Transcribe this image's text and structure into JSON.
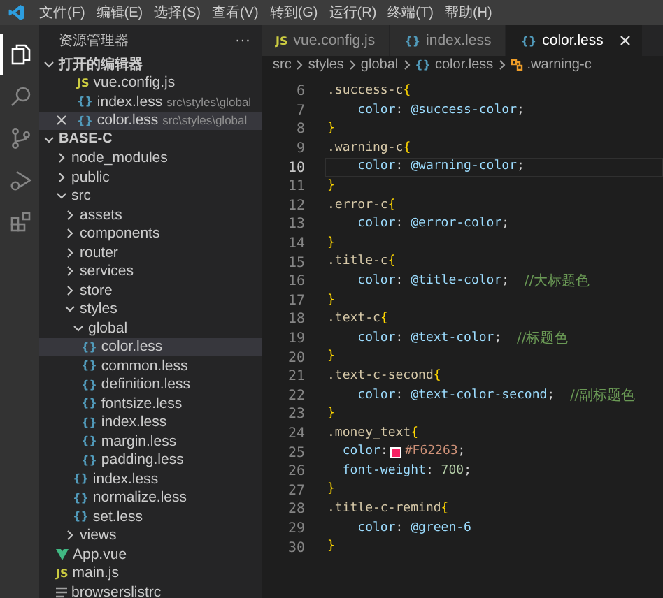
{
  "menu": [
    "文件(F)",
    "编辑(E)",
    "选择(S)",
    "查看(V)",
    "转到(G)",
    "运行(R)",
    "终端(T)",
    "帮助(H)"
  ],
  "activity_bar": [
    {
      "kind": "files",
      "selected": true
    },
    {
      "kind": "search",
      "selected": false
    },
    {
      "kind": "source-control",
      "selected": false
    },
    {
      "kind": "run",
      "selected": false
    },
    {
      "kind": "extensions",
      "selected": false
    }
  ],
  "sidebar": {
    "title": "资源管理器",
    "more": "···",
    "open_editors": {
      "title": "打开的编辑器",
      "expanded": true,
      "items": [
        {
          "kind": "js",
          "badge": "JS",
          "name": "vue.config.js",
          "selected": false
        },
        {
          "kind": "less",
          "badge": "{}",
          "name": "index.less",
          "path": "src\\styles\\global",
          "selected": false
        },
        {
          "kind": "less",
          "badge": "{}",
          "name": "color.less",
          "path": "src\\styles\\global",
          "selected": true
        }
      ]
    },
    "project": {
      "title": "BASE-C",
      "expanded": true,
      "tree": [
        {
          "kind": "folder",
          "name": "node_modules",
          "expanded": false,
          "selected": false
        },
        {
          "kind": "folder",
          "name": "public",
          "expanded": false,
          "selected": false
        },
        {
          "kind": "folder",
          "name": "src",
          "expanded": true,
          "selected": false,
          "children": [
            {
              "kind": "folder",
              "name": "assets",
              "expanded": false,
              "selected": false
            },
            {
              "kind": "folder",
              "name": "components",
              "expanded": false,
              "selected": false
            },
            {
              "kind": "folder",
              "name": "router",
              "expanded": false,
              "selected": false
            },
            {
              "kind": "folder",
              "name": "services",
              "expanded": false,
              "selected": false
            },
            {
              "kind": "folder",
              "name": "store",
              "expanded": false,
              "selected": false
            },
            {
              "kind": "folder",
              "name": "styles",
              "expanded": true,
              "selected": false,
              "children": [
                {
                  "kind": "folder",
                  "name": "global",
                  "expanded": true,
                  "selected": false,
                  "children": [
                    {
                      "kind": "less",
                      "badge": "{}",
                      "name": "color.less",
                      "selected": true
                    },
                    {
                      "kind": "less",
                      "badge": "{}",
                      "name": "common.less",
                      "selected": false
                    },
                    {
                      "kind": "less",
                      "badge": "{}",
                      "name": "definition.less",
                      "selected": false
                    },
                    {
                      "kind": "less",
                      "badge": "{}",
                      "name": "fontsize.less",
                      "selected": false
                    },
                    {
                      "kind": "less",
                      "badge": "{}",
                      "name": "index.less",
                      "selected": false
                    },
                    {
                      "kind": "less",
                      "badge": "{}",
                      "name": "margin.less",
                      "selected": false
                    },
                    {
                      "kind": "less",
                      "badge": "{}",
                      "name": "padding.less",
                      "selected": false
                    }
                  ]
                },
                {
                  "kind": "less",
                  "badge": "{}",
                  "name": "index.less",
                  "selected": false
                },
                {
                  "kind": "less",
                  "badge": "{}",
                  "name": "normalize.less",
                  "selected": false
                },
                {
                  "kind": "less",
                  "badge": "{}",
                  "name": "set.less",
                  "selected": false
                }
              ]
            },
            {
              "kind": "folder",
              "name": "views",
              "expanded": false,
              "selected": false
            }
          ]
        },
        {
          "kind": "vue",
          "name": "App.vue",
          "selected": false
        },
        {
          "kind": "js",
          "badge": "JS",
          "name": "main.js",
          "selected": false
        },
        {
          "kind": "file",
          "name": "browserslistrc",
          "selected": false
        }
      ]
    }
  },
  "tabs": [
    {
      "kind": "js",
      "badge": "JS",
      "label": "vue.config.js",
      "selected": false
    },
    {
      "kind": "less",
      "badge": "{}",
      "label": "index.less",
      "selected": false
    },
    {
      "kind": "less",
      "badge": "{}",
      "label": "color.less",
      "selected": true
    }
  ],
  "breadcrumbs": [
    {
      "kind": "folder",
      "text": "src"
    },
    {
      "kind": "folder",
      "text": "styles"
    },
    {
      "kind": "folder",
      "text": "global"
    },
    {
      "kind": "less",
      "badge": "{}",
      "text": "color.less"
    },
    {
      "kind": "symbol",
      "text": ".warning-c"
    }
  ],
  "code": [
    {
      "number": "6",
      "current": false,
      "tokens": [
        {
          "kind": "selector",
          "text": ".success-c"
        },
        {
          "kind": "brace",
          "text": "{"
        }
      ]
    },
    {
      "number": "7",
      "current": false,
      "tokens": [
        {
          "kind": "property",
          "text": "    color"
        },
        {
          "kind": "punct",
          "text": ": "
        },
        {
          "kind": "variable",
          "text": "@success-color"
        },
        {
          "kind": "punct",
          "text": ";"
        }
      ]
    },
    {
      "number": "8",
      "current": false,
      "tokens": [
        {
          "kind": "brace",
          "text": "}"
        }
      ]
    },
    {
      "number": "9",
      "current": false,
      "tokens": [
        {
          "kind": "selector",
          "text": ".warning-c"
        },
        {
          "kind": "brace",
          "text": "{"
        }
      ]
    },
    {
      "number": "10",
      "current": true,
      "tokens": [
        {
          "kind": "property",
          "text": "    color"
        },
        {
          "kind": "punct",
          "text": ": "
        },
        {
          "kind": "variable",
          "text": "@warning-color"
        },
        {
          "kind": "punct",
          "text": ";"
        }
      ]
    },
    {
      "number": "11",
      "current": false,
      "tokens": [
        {
          "kind": "brace",
          "text": "}"
        }
      ]
    },
    {
      "number": "12",
      "current": false,
      "tokens": [
        {
          "kind": "selector",
          "text": ".error-c"
        },
        {
          "kind": "brace",
          "text": "{"
        }
      ]
    },
    {
      "number": "13",
      "current": false,
      "tokens": [
        {
          "kind": "property",
          "text": "    color"
        },
        {
          "kind": "punct",
          "text": ": "
        },
        {
          "kind": "variable",
          "text": "@error-color"
        },
        {
          "kind": "punct",
          "text": ";"
        }
      ]
    },
    {
      "number": "14",
      "current": false,
      "tokens": [
        {
          "kind": "brace",
          "text": "}"
        }
      ]
    },
    {
      "number": "15",
      "current": false,
      "tokens": [
        {
          "kind": "selector",
          "text": ".title-c"
        },
        {
          "kind": "brace",
          "text": "{"
        }
      ]
    },
    {
      "number": "16",
      "current": false,
      "tokens": [
        {
          "kind": "property",
          "text": "    color"
        },
        {
          "kind": "punct",
          "text": ": "
        },
        {
          "kind": "variable",
          "text": "@title-color"
        },
        {
          "kind": "punct",
          "text": ";  "
        },
        {
          "kind": "comment",
          "text": "//大标题色"
        }
      ]
    },
    {
      "number": "17",
      "current": false,
      "tokens": [
        {
          "kind": "brace",
          "text": "}"
        }
      ]
    },
    {
      "number": "18",
      "current": false,
      "tokens": [
        {
          "kind": "selector",
          "text": ".text-c"
        },
        {
          "kind": "brace",
          "text": "{"
        }
      ]
    },
    {
      "number": "19",
      "current": false,
      "tokens": [
        {
          "kind": "property",
          "text": "    color"
        },
        {
          "kind": "punct",
          "text": ": "
        },
        {
          "kind": "variable",
          "text": "@text-color"
        },
        {
          "kind": "punct",
          "text": ";  "
        },
        {
          "kind": "comment",
          "text": "//标题色"
        }
      ]
    },
    {
      "number": "20",
      "current": false,
      "tokens": [
        {
          "kind": "brace",
          "text": "}"
        }
      ]
    },
    {
      "number": "21",
      "current": false,
      "tokens": [
        {
          "kind": "selector",
          "text": ".text-c-second"
        },
        {
          "kind": "brace",
          "text": "{"
        }
      ]
    },
    {
      "number": "22",
      "current": false,
      "tokens": [
        {
          "kind": "property",
          "text": "    color"
        },
        {
          "kind": "punct",
          "text": ": "
        },
        {
          "kind": "variable",
          "text": "@text-color-second"
        },
        {
          "kind": "punct",
          "text": ";  "
        },
        {
          "kind": "comment",
          "text": "//副标题色"
        }
      ]
    },
    {
      "number": "23",
      "current": false,
      "tokens": [
        {
          "kind": "brace",
          "text": "}"
        }
      ]
    },
    {
      "number": "24",
      "current": false,
      "tokens": [
        {
          "kind": "selector",
          "text": ".money_text"
        },
        {
          "kind": "brace",
          "text": "{"
        }
      ]
    },
    {
      "number": "25",
      "current": false,
      "tokens": [
        {
          "kind": "property",
          "text": "  color"
        },
        {
          "kind": "punct",
          "text": ":"
        },
        {
          "kind": "swatch",
          "color": "#f62263"
        },
        {
          "kind": "string",
          "text": "#F62263"
        },
        {
          "kind": "punct",
          "text": ";"
        }
      ]
    },
    {
      "number": "26",
      "current": false,
      "tokens": [
        {
          "kind": "property",
          "text": "  font-weight"
        },
        {
          "kind": "punct",
          "text": ": "
        },
        {
          "kind": "number",
          "text": "700"
        },
        {
          "kind": "punct",
          "text": ";"
        }
      ]
    },
    {
      "number": "27",
      "current": false,
      "tokens": [
        {
          "kind": "brace",
          "text": "}"
        }
      ]
    },
    {
      "number": "28",
      "current": false,
      "tokens": [
        {
          "kind": "selector",
          "text": ".title-c-remind"
        },
        {
          "kind": "brace",
          "text": "{"
        }
      ]
    },
    {
      "number": "29",
      "current": false,
      "tokens": [
        {
          "kind": "property",
          "text": "    color"
        },
        {
          "kind": "punct",
          "text": ": "
        },
        {
          "kind": "variable",
          "text": "@green-6"
        }
      ]
    },
    {
      "number": "30",
      "current": false,
      "tokens": [
        {
          "kind": "brace",
          "text": "}"
        }
      ]
    }
  ]
}
